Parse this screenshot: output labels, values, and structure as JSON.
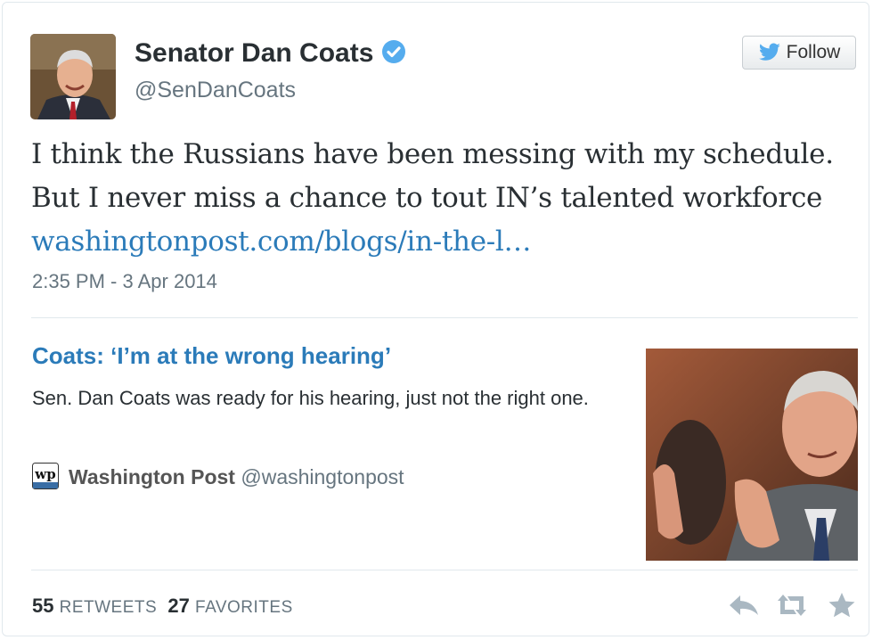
{
  "author": {
    "name": "Senator Dan Coats",
    "handle": "@SenDanCoats",
    "verified_icon": "verified-badge-icon",
    "follow_label": "Follow"
  },
  "tweet": {
    "text": "I think the Russians have been messing with my schedule. But I never miss a chance to tout IN’s talented workforce",
    "link": "washingtonpost.com/blogs/in-the-l…",
    "timestamp": "2:35 PM - 3 Apr 2014"
  },
  "card": {
    "title": "Coats: ‘I’m at the wrong hearing’",
    "description": "Sen. Dan Coats was ready for his hearing, just not the right one.",
    "source_name": "Washington Post",
    "source_handle": "@washingtonpost",
    "logo_text": "wp"
  },
  "stats": {
    "retweets_count": "55",
    "retweets_label": "RETWEETS",
    "favorites_count": "27",
    "favorites_label": "FAVORITES"
  },
  "colors": {
    "link": "#2b7bb9",
    "twitter_blue": "#55acee",
    "muted": "#66757f"
  }
}
